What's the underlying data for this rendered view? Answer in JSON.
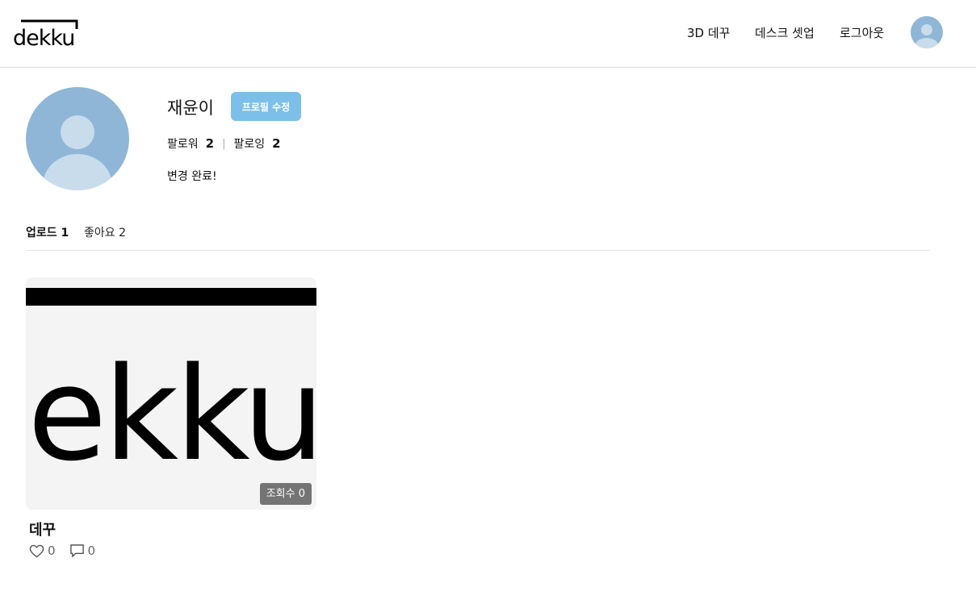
{
  "header": {
    "logo_text": "dekku",
    "nav": {
      "item_3d": "3D 데꾸",
      "item_desk": "데스크 셋업",
      "item_logout": "로그아웃"
    },
    "avatar_icon": "user-avatar-icon"
  },
  "profile": {
    "username": "재윤이",
    "edit_button": "프로필 수정",
    "followers_label": "팔로워",
    "followers_count": "2",
    "separator": "|",
    "following_label": "팔로잉",
    "following_count": "2",
    "bio": "변경 완료!"
  },
  "tabs": {
    "upload": "업로드 1",
    "likes": "좋아요 2"
  },
  "posts": [
    {
      "thumb_text": "ekku",
      "views": "조회수 0",
      "title": "데꾸",
      "likes": "0",
      "comments": "0"
    }
  ],
  "colors": {
    "accent": "#7cc0ea",
    "avatar_bg": "#8fb6d6",
    "avatar_fg": "#c9dcec",
    "divider": "#dedede"
  }
}
